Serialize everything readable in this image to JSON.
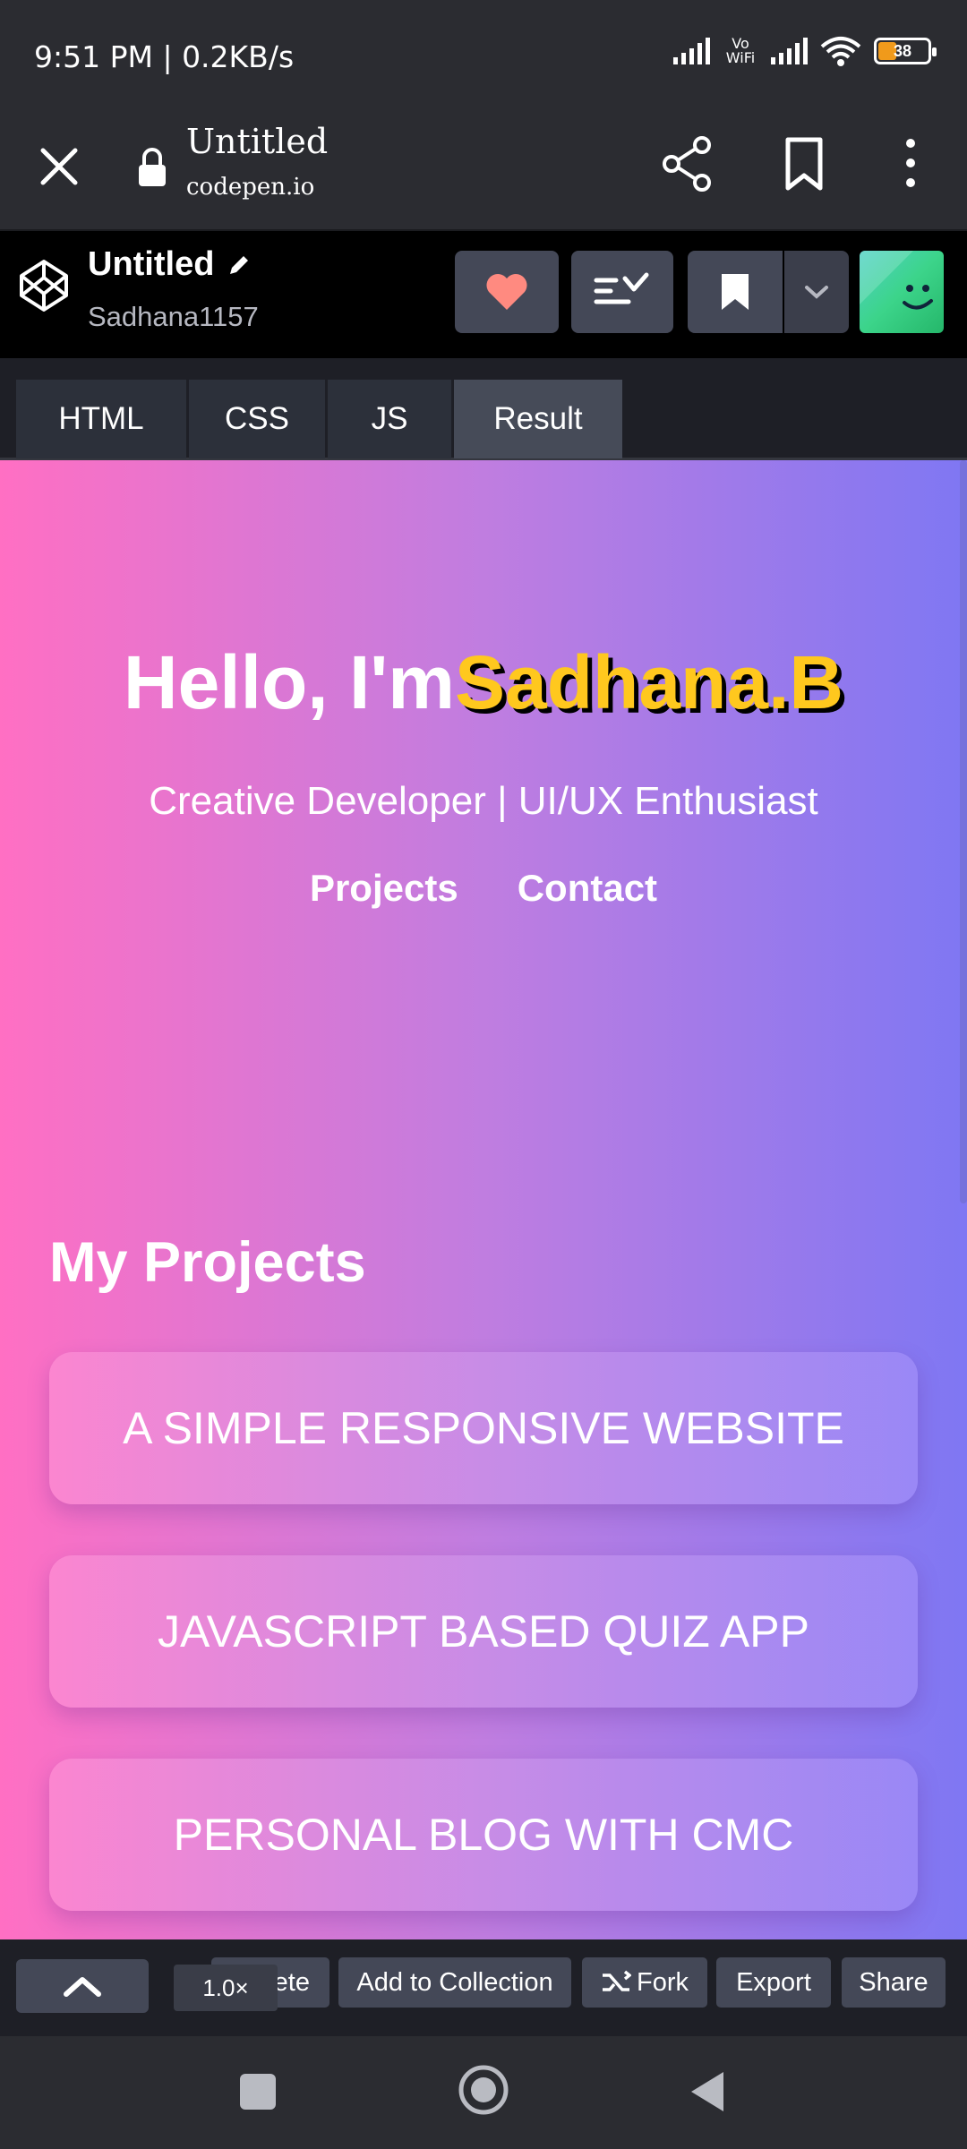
{
  "status_bar": {
    "time": "9:51 PM | 0.2KB/s",
    "network_label": "Vo WiFi",
    "battery": "38"
  },
  "browser": {
    "title": "Untitled",
    "url": "codepen.io"
  },
  "codepen": {
    "title": "Untitled",
    "username": "Sadhana1157",
    "tabs": [
      "HTML",
      "CSS",
      "JS",
      "Result"
    ],
    "active_tab": "Result"
  },
  "result": {
    "greeting": "Hello, I'm",
    "name": "Sadhana.B",
    "subtitle": "Creative Developer | UI/UX Enthusiast",
    "nav": [
      "Projects",
      "Contact"
    ],
    "projects_heading": "My Projects",
    "projects": [
      "A SIMPLE RESPONSIVE WEBSITE",
      "JAVASCRIPT BASED QUIZ APP",
      "PERSONAL BLOG WITH CMC"
    ]
  },
  "actions": {
    "zoom": "1.0×",
    "delete_partial": "ete",
    "add_to_collection": "Add to Collection",
    "fork": "Fork",
    "export": "Export",
    "share": "Share"
  },
  "colors": {
    "gradient_start": "#ff6fc3",
    "gradient_end": "#7f77f3",
    "name_color": "#ffc81e",
    "heart": "#ff8a80"
  }
}
